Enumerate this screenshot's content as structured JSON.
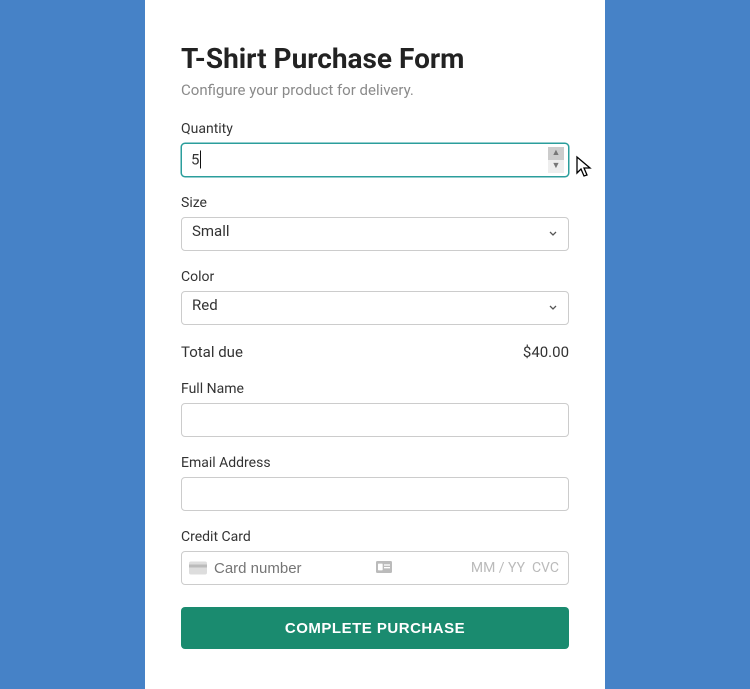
{
  "form": {
    "title": "T-Shirt Purchase Form",
    "subtitle": "Configure your product for delivery.",
    "quantity": {
      "label": "Quantity",
      "value": "5"
    },
    "size": {
      "label": "Size",
      "value": "Small"
    },
    "color": {
      "label": "Color",
      "value": "Red"
    },
    "total": {
      "label": "Total due",
      "value": "$40.00"
    },
    "full_name": {
      "label": "Full Name",
      "value": ""
    },
    "email": {
      "label": "Email Address",
      "value": ""
    },
    "credit_card": {
      "label": "Credit Card",
      "placeholder": "Card number",
      "exp_placeholder": "MM / YY",
      "cvc_placeholder": "CVC"
    },
    "submit_label": "COMPLETE PURCHASE"
  }
}
